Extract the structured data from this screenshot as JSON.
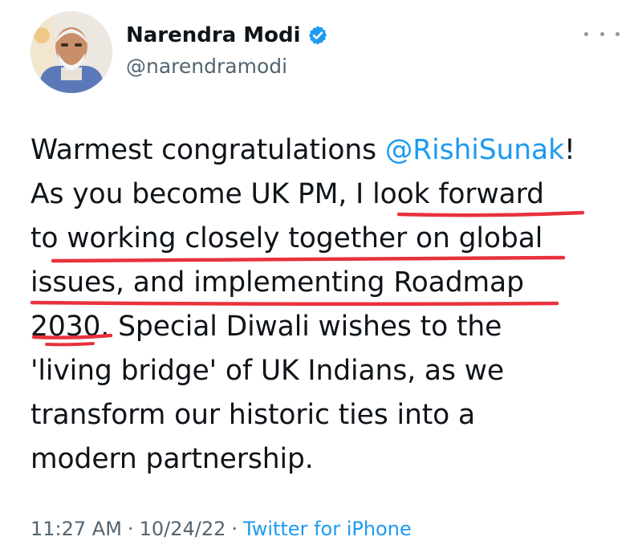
{
  "author": {
    "name": "Narendra Modi",
    "handle": "@narendramodi",
    "verified": true
  },
  "tweet": {
    "lines": [
      {
        "before": "Warmest congratulations ",
        "mention": "@RishiSunak",
        "after": "!"
      },
      {
        "text": "As you become UK PM, I look forward"
      },
      {
        "text": "to working closely together on global"
      },
      {
        "text": "issues, and implementing Roadmap"
      },
      {
        "text": "2030. Special Diwali wishes to the"
      },
      {
        "text": "'living bridge' of UK Indians, as we"
      },
      {
        "text": "transform our historic ties into a"
      },
      {
        "text": "modern partnership."
      }
    ]
  },
  "meta": {
    "time": "11:27 AM",
    "date": "10/24/22",
    "separator": "·",
    "source": "Twitter for iPhone"
  },
  "colors": {
    "link": "#1d9bf0",
    "secondary_text": "#536471",
    "annotation_red": "#e8323c"
  },
  "icons": {
    "more": "more-horizontal-icon",
    "verified": "verified-badge-icon"
  }
}
